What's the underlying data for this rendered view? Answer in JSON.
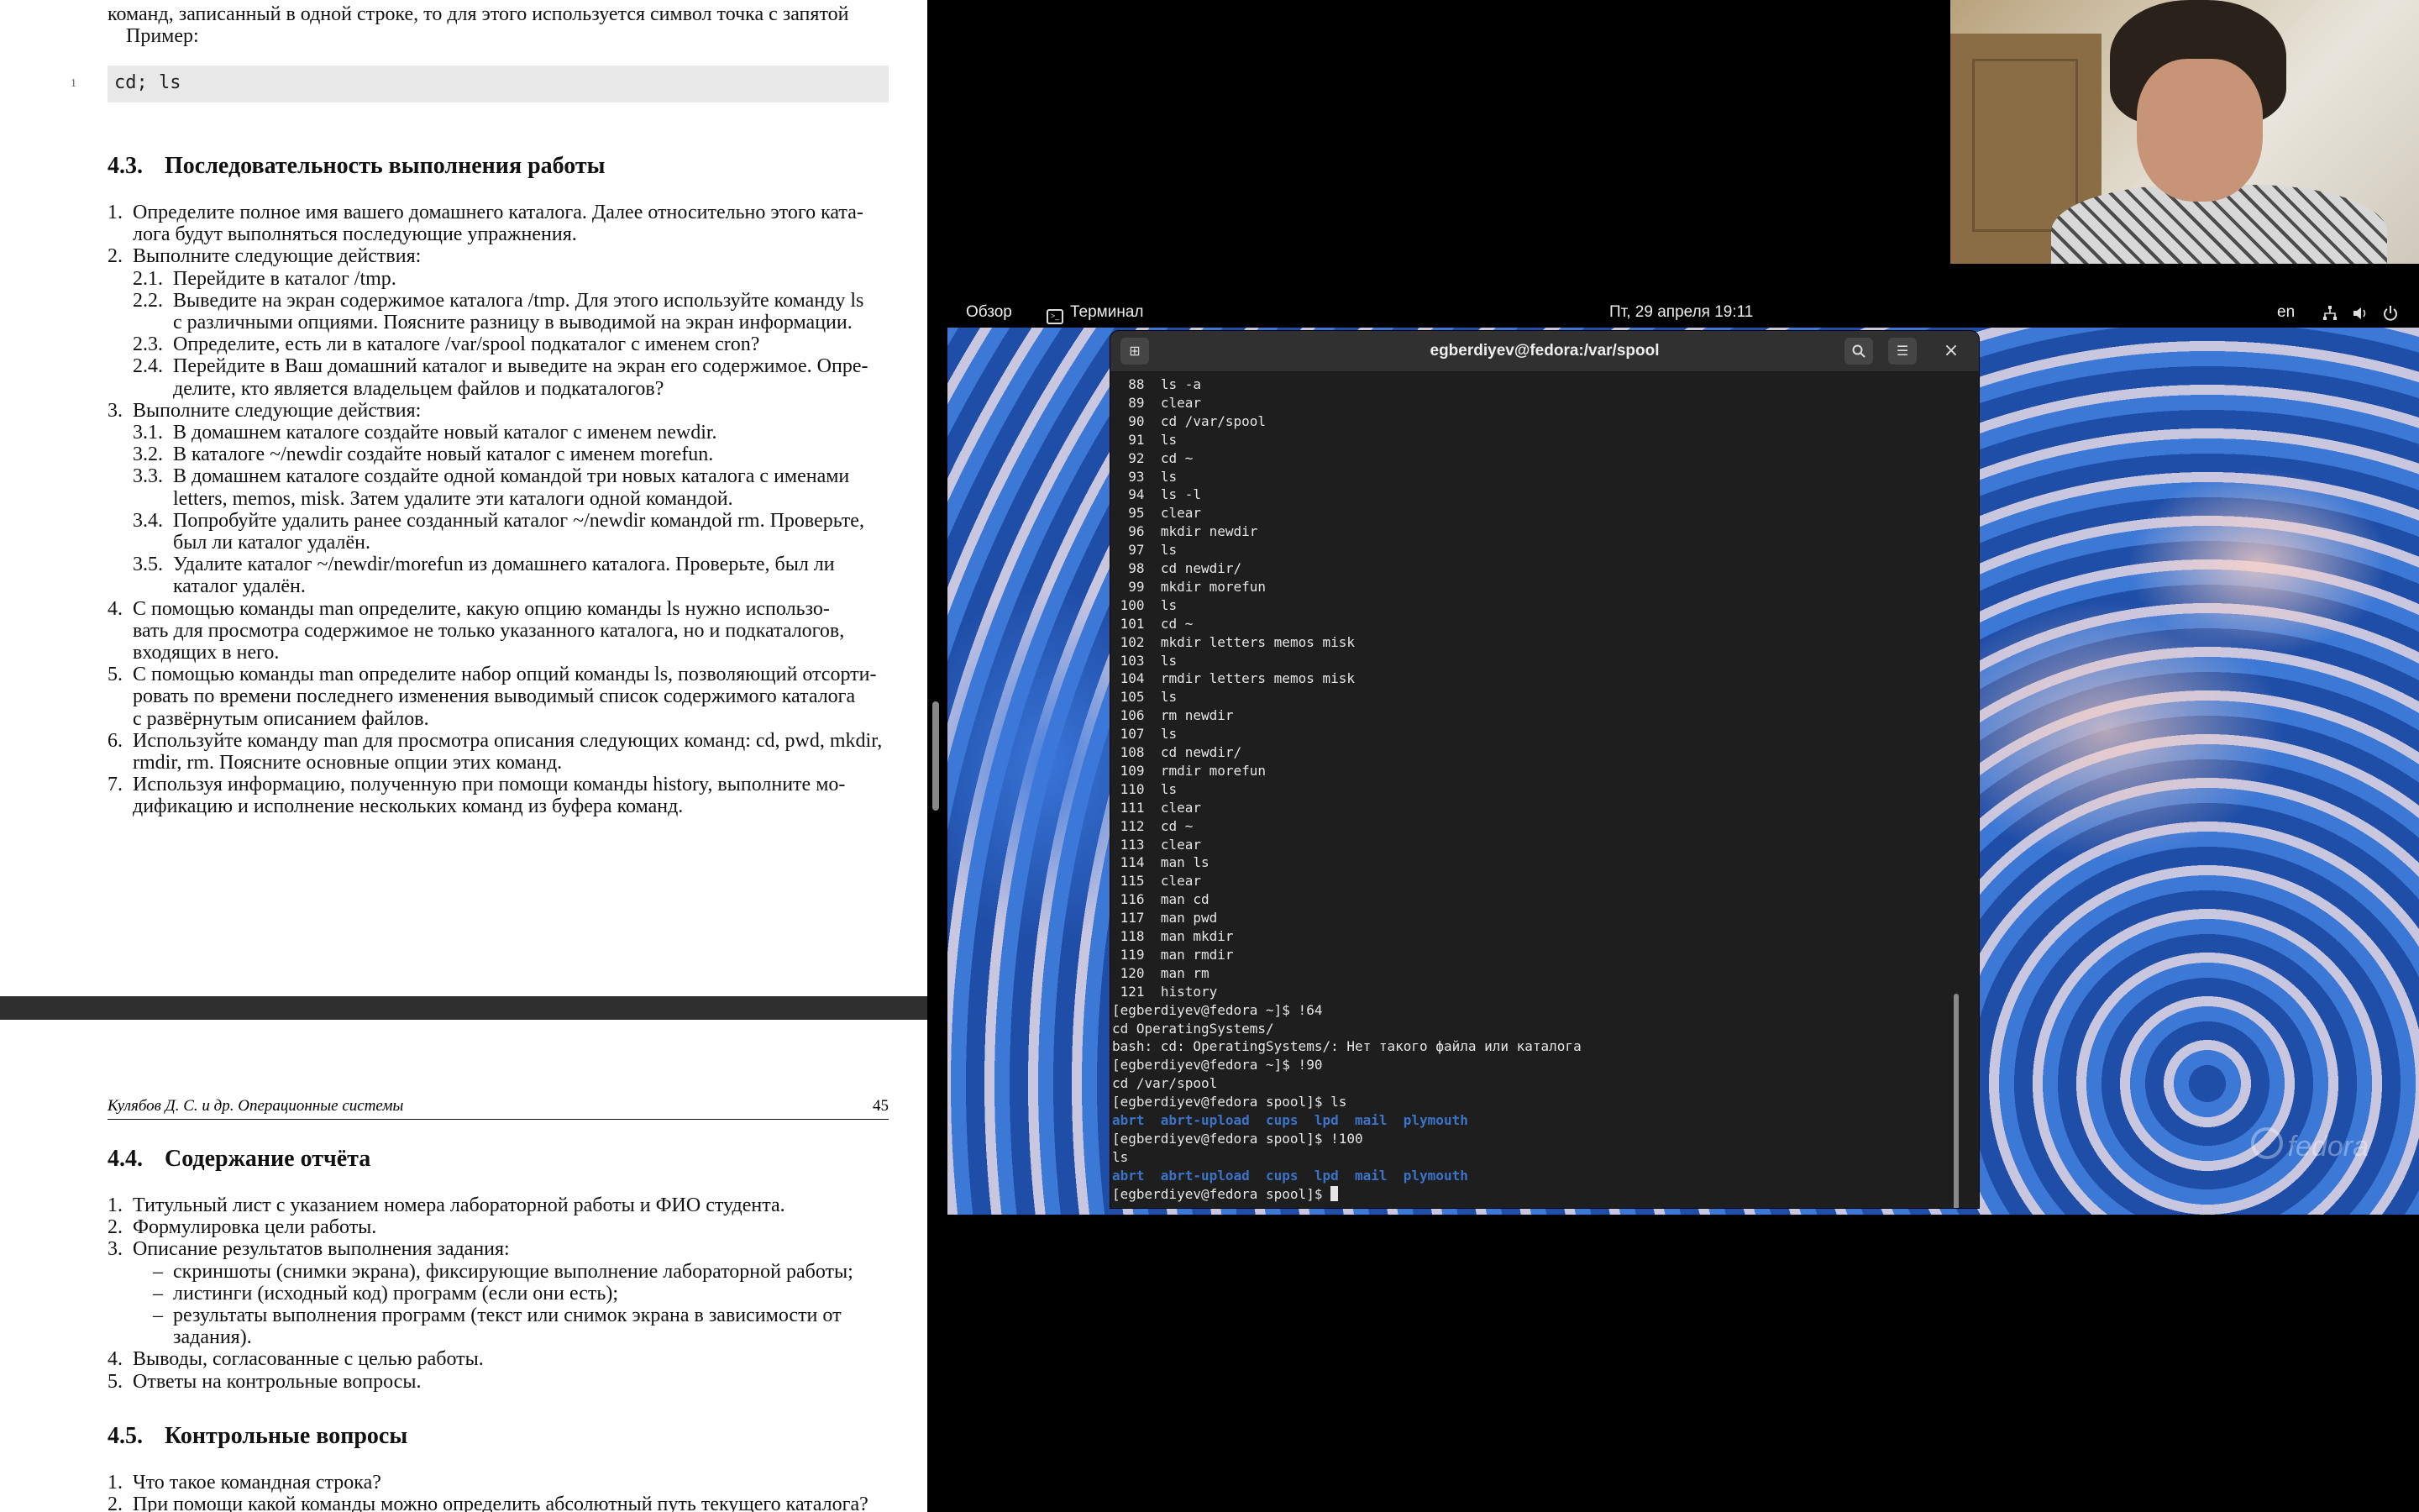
{
  "document": {
    "top_page": {
      "intro_line": "команд, записанный в одной строке, то для этого используется символ точка с запятой",
      "example_label": "Пример:",
      "code_line_number": "1",
      "code": "cd; ls",
      "section_43": {
        "number": "4.3.",
        "title": "Последовательность выполнения работы"
      },
      "items": [
        {
          "n": "1.",
          "text": "Определите полное имя вашего домашнего каталога. Далее относительно этого ката-"
        },
        {
          "n": "",
          "text": "лога будут выполняться последующие упражнения."
        },
        {
          "n": "2.",
          "text": "Выполните следующие действия:"
        },
        {
          "n": "2.1.",
          "text": "Перейдите в каталог /tmp."
        },
        {
          "n": "2.2.",
          "text": "Выведите на экран содержимое каталога /tmp. Для этого используйте команду ls"
        },
        {
          "n": "",
          "text": "с различными опциями. Поясните разницу в выводимой на экран информации."
        },
        {
          "n": "2.3.",
          "text": "Определите, есть ли в каталоге /var/spool подкаталог с именем cron?"
        },
        {
          "n": "2.4.",
          "text": "Перейдите в Ваш домашний каталог и выведите на экран его содержимое. Опре-"
        },
        {
          "n": "",
          "text": "делите, кто является владельцем файлов и подкаталогов?"
        },
        {
          "n": "3.",
          "text": "Выполните следующие действия:"
        },
        {
          "n": "3.1.",
          "text": "В домашнем каталоге создайте новый каталог с именем newdir."
        },
        {
          "n": "3.2.",
          "text": "В каталоге ~/newdir создайте новый каталог с именем morefun."
        },
        {
          "n": "3.3.",
          "text": "В домашнем каталоге создайте одной командой три новых каталога с именами"
        },
        {
          "n": "",
          "text": "letters, memos, misk. Затем удалите эти каталоги одной командой."
        },
        {
          "n": "3.4.",
          "text": "Попробуйте удалить ранее созданный каталог ~/newdir командой rm. Проверьте,"
        },
        {
          "n": "",
          "text": "был ли каталог удалён."
        },
        {
          "n": "3.5.",
          "text": "Удалите каталог ~/newdir/morefun из домашнего каталога. Проверьте, был ли"
        },
        {
          "n": "",
          "text": "каталог удалён."
        },
        {
          "n": "4.",
          "text": "С помощью команды man определите, какую опцию команды ls нужно использо-"
        },
        {
          "n": "",
          "text": "вать для просмотра содержимое не только указанного каталога, но и подкаталогов,"
        },
        {
          "n": "",
          "text": "входящих в него."
        },
        {
          "n": "5.",
          "text": "С помощью команды man определите набор опций команды ls, позволяющий отсорти-"
        },
        {
          "n": "",
          "text": "ровать по времени последнего изменения выводимый список содержимого каталога"
        },
        {
          "n": "",
          "text": "с развёрнутым описанием файлов."
        },
        {
          "n": "6.",
          "text": "Используйте команду man для просмотра описания следующих команд: cd, pwd, mkdir,"
        },
        {
          "n": "",
          "text": "rmdir, rm. Поясните основные опции этих команд."
        },
        {
          "n": "7.",
          "text": "Используя информацию, полученную при помощи команды history, выполните мо-"
        },
        {
          "n": "",
          "text": "дификацию и исполнение нескольких команд из буфера команд."
        }
      ]
    },
    "bottom_page": {
      "running_head": "Кулябов Д. С. и др. Операционные системы",
      "page_number": "45",
      "section_44": {
        "number": "4.4.",
        "title": "Содержание отчёта"
      },
      "report_items": [
        {
          "n": "1.",
          "text": "Титульный лист с указанием номера лабораторной работы и ФИО студента."
        },
        {
          "n": "2.",
          "text": "Формулировка цели работы."
        },
        {
          "n": "3.",
          "text": "Описание результатов выполнения задания:"
        },
        {
          "n": "–",
          "text": "скриншоты (снимки экрана), фиксирующие выполнение лабораторной работы;"
        },
        {
          "n": "–",
          "text": "листинги (исходный код) программ (если они есть);"
        },
        {
          "n": "–",
          "text": "результаты выполнения программ (текст или снимок экрана в зависимости от"
        },
        {
          "n": "",
          "text": "задания)."
        },
        {
          "n": "4.",
          "text": "Выводы, согласованные с целью работы."
        },
        {
          "n": "5.",
          "text": "Ответы на контрольные вопросы."
        }
      ],
      "section_45": {
        "number": "4.5.",
        "title": "Контрольные вопросы"
      },
      "questions": [
        {
          "n": "1.",
          "text": "Что такое командная строка?"
        },
        {
          "n": "2.",
          "text": "При помощи какой команды можно определить абсолютный путь текущего каталога?"
        }
      ]
    }
  },
  "topbar": {
    "overview": "Обзор",
    "app": "Терминал",
    "clock": "Пт, 29 апреля  19:11",
    "lang": "en"
  },
  "terminal": {
    "title": "egberdiyev@fedora:/var/spool",
    "history": [
      {
        "n": " 88",
        "cmd": "ls -a"
      },
      {
        "n": " 89",
        "cmd": "clear"
      },
      {
        "n": " 90",
        "cmd": "cd /var/spool"
      },
      {
        "n": " 91",
        "cmd": "ls"
      },
      {
        "n": " 92",
        "cmd": "cd ~"
      },
      {
        "n": " 93",
        "cmd": "ls"
      },
      {
        "n": " 94",
        "cmd": "ls -l"
      },
      {
        "n": " 95",
        "cmd": "clear"
      },
      {
        "n": " 96",
        "cmd": "mkdir newdir"
      },
      {
        "n": " 97",
        "cmd": "ls"
      },
      {
        "n": " 98",
        "cmd": "cd newdir/"
      },
      {
        "n": " 99",
        "cmd": "mkdir morefun"
      },
      {
        "n": "100",
        "cmd": "ls"
      },
      {
        "n": "101",
        "cmd": "cd ~"
      },
      {
        "n": "102",
        "cmd": "mkdir letters memos misk"
      },
      {
        "n": "103",
        "cmd": "ls"
      },
      {
        "n": "104",
        "cmd": "rmdir letters memos misk"
      },
      {
        "n": "105",
        "cmd": "ls"
      },
      {
        "n": "106",
        "cmd": "rm newdir"
      },
      {
        "n": "107",
        "cmd": "ls"
      },
      {
        "n": "108",
        "cmd": "cd newdir/"
      },
      {
        "n": "109",
        "cmd": "rmdir morefun"
      },
      {
        "n": "110",
        "cmd": "ls"
      },
      {
        "n": "111",
        "cmd": "clear"
      },
      {
        "n": "112",
        "cmd": "cd ~"
      },
      {
        "n": "113",
        "cmd": "clear"
      },
      {
        "n": "114",
        "cmd": "man ls"
      },
      {
        "n": "115",
        "cmd": "clear"
      },
      {
        "n": "116",
        "cmd": "man cd"
      },
      {
        "n": "117",
        "cmd": "man pwd"
      },
      {
        "n": "118",
        "cmd": "man mkdir"
      },
      {
        "n": "119",
        "cmd": "man rmdir"
      },
      {
        "n": "120",
        "cmd": "man rm"
      },
      {
        "n": "121",
        "cmd": "history"
      }
    ],
    "tail": [
      {
        "text": "[egberdiyev@fedora ~]$ !64",
        "style": "plain"
      },
      {
        "text": "cd OperatingSystems/",
        "style": "plain"
      },
      {
        "text": "bash: cd: OperatingSystems/: Нет такого файла или каталога",
        "style": "plain"
      },
      {
        "text": "[egberdiyev@fedora ~]$ !90",
        "style": "plain"
      },
      {
        "text": "cd /var/spool",
        "style": "plain"
      },
      {
        "text": "[egberdiyev@fedora spool]$ ls",
        "style": "plain"
      },
      {
        "text": "abrt  abrt-upload  cups  lpd  mail  plymouth",
        "style": "dir"
      },
      {
        "text": "[egberdiyev@fedora spool]$ !100",
        "style": "plain"
      },
      {
        "text": "ls",
        "style": "plain"
      },
      {
        "text": "abrt  abrt-upload  cups  lpd  mail  plymouth",
        "style": "dir"
      }
    ],
    "prompt": "[egberdiyev@fedora spool]$ "
  },
  "desktop": {
    "logo": "fedora"
  },
  "icons": [
    "new-tab-icon",
    "search-icon",
    "hamburger-menu-icon",
    "close-icon",
    "terminal-icon",
    "network-icon",
    "volume-icon",
    "power-icon"
  ]
}
